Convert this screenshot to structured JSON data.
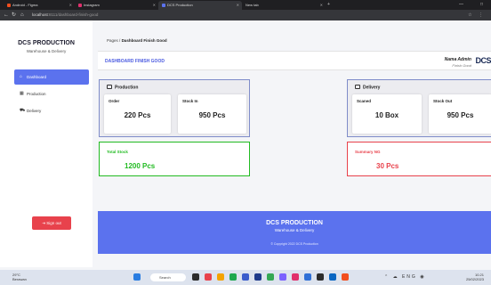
{
  "browser": {
    "tabs": [
      {
        "label": "Android - Figma",
        "favicon_color": "#f24e1e"
      },
      {
        "label": "Instagram",
        "favicon_color": "#e1306c"
      },
      {
        "label": "DCS Production",
        "favicon_color": "#5b72ee"
      },
      {
        "label": "New tab",
        "favicon_color": "#888888"
      }
    ],
    "url_host": "localhost",
    "url_path": ":8111/dashboard-finish-good"
  },
  "sidebar": {
    "brand": "DCS PRODUCTION",
    "brand_sub": "Warehouse & Delivery",
    "items": [
      {
        "label": "Dashboard",
        "icon": "home-icon"
      },
      {
        "label": "Production",
        "icon": "boxes-icon"
      },
      {
        "label": "Delivery",
        "icon": "truck-icon"
      }
    ],
    "signout": "Sign out"
  },
  "breadcrumb": {
    "root": "Pages",
    "sep": "/",
    "current": "Dashboard Finish Good"
  },
  "header": {
    "title": "DASHBOARD FINISH GOOD",
    "user_name": "Nama Admin",
    "user_role": "Finish Good",
    "logo": "DCS"
  },
  "production": {
    "title": "Production",
    "cards": [
      {
        "label": "Order",
        "value": "220 Pcs"
      },
      {
        "label": "Stock In",
        "value": "950 Pcs"
      }
    ]
  },
  "delivery": {
    "title": "Delivery",
    "cards": [
      {
        "label": "Scaned",
        "value": "10 Box"
      },
      {
        "label": "Stock Out",
        "value": "950 Pcs"
      }
    ]
  },
  "total_stock": {
    "label": "Total Stock",
    "value": "1200 Pcs",
    "color": "#22bb22"
  },
  "summary_ng": {
    "label": "Summary NG",
    "value": "30 Pcs",
    "color": "#e8424c"
  },
  "footer": {
    "title": "DCS PRODUCTION",
    "subtitle": "Warehouse & Delivery",
    "copyright": "© Copyright 2022 DCS Production"
  },
  "taskbar": {
    "weather_temp": "29°C",
    "weather_desc": "Berawan",
    "search": "Search",
    "time": "10.21",
    "date": "25/02/2023",
    "lang": "ENG"
  },
  "colors": {
    "accent": "#5b72ee",
    "danger": "#e8424c",
    "success": "#22bb22"
  }
}
